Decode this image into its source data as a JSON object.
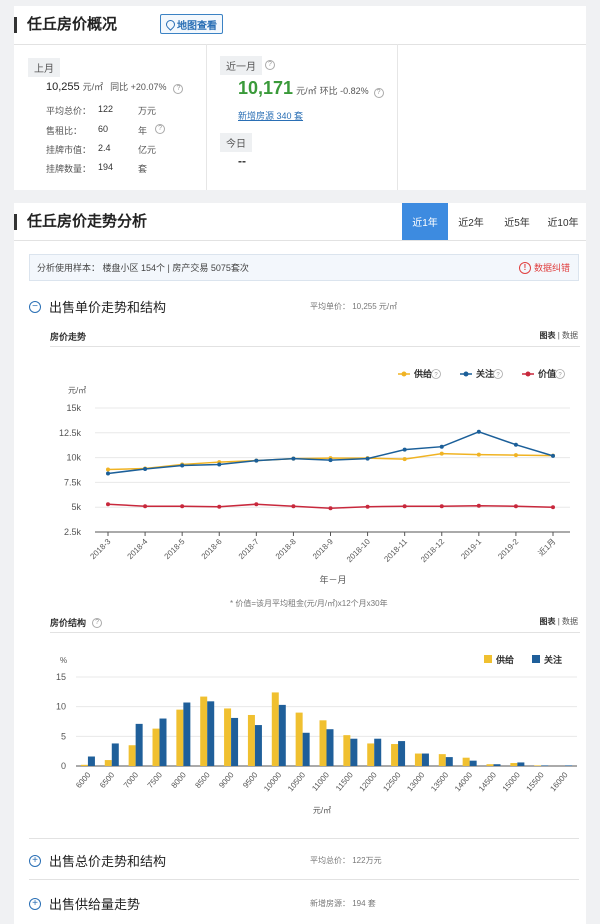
{
  "overview": {
    "title": "任丘房价概况",
    "map_button": "地图查看",
    "last_month": {
      "tag": "上月",
      "price": "10,255",
      "unit": "元/㎡",
      "yoy": "同比 +20.07%",
      "stats": [
        {
          "label": "平均总价：",
          "value": "122",
          "unit": "万元"
        },
        {
          "label": "售租比：",
          "value": "60",
          "unit": "年"
        },
        {
          "label": "挂牌市值：",
          "value": "2.4",
          "unit": "亿元"
        },
        {
          "label": "挂牌数量：",
          "value": "194",
          "unit": "套"
        }
      ]
    },
    "recent_month": {
      "tag": "近一月",
      "price": "10,171",
      "unit": "元/㎡",
      "mom": "环比 -0.82%",
      "new_listings": "新增房源 340 套"
    },
    "today": {
      "tag": "今日",
      "value": "--"
    }
  },
  "trend": {
    "title": "任丘房价走势分析",
    "tabs": [
      "近1年",
      "近2年",
      "近5年",
      "近10年"
    ],
    "active_tab": 0,
    "sample_text": "分析使用样本：  楼盘小区 154个   |   房产交易 5075套次",
    "error_label": "数据纠错",
    "unit_section": {
      "heading": "出售单价走势和结构",
      "avg": "平均单价：  10,255 元/㎡",
      "price_trend_label": "房价走势",
      "view_chart": "图表",
      "view_data": "数据",
      "footnote": "* 价值=该月平均租金(元/月/㎡)x12个月x30年",
      "structure_label": "房价结构"
    },
    "total_section": {
      "heading": "出售总价走势和结构",
      "avg": "平均总价：  122万元"
    },
    "supply_section": {
      "heading": "出售供给量走势",
      "avg": "新增房源：  194 套"
    }
  },
  "chart_data": [
    {
      "type": "line",
      "ylabel": "元/㎡",
      "xlabel": "年－月",
      "y_ticks": [
        "2.5k",
        "5k",
        "7.5k",
        "10k",
        "12.5k",
        "15k"
      ],
      "ylim": [
        2500,
        15000
      ],
      "categories": [
        "2018-3",
        "2018-4",
        "2018-5",
        "2018-6",
        "2018-7",
        "2018-8",
        "2018-9",
        "2018-10",
        "2018-11",
        "2018-12",
        "2019-1",
        "2019-2",
        "近1月"
      ],
      "series": [
        {
          "name": "供给",
          "color": "#f0b323",
          "values": [
            8800,
            8900,
            9300,
            9550,
            9700,
            9900,
            9950,
            9950,
            9850,
            10400,
            10300,
            10250,
            10200
          ]
        },
        {
          "name": "关注",
          "color": "#1b5f99",
          "values": [
            8400,
            8850,
            9200,
            9300,
            9700,
            9900,
            9750,
            9900,
            10800,
            11100,
            12600,
            11300,
            10171
          ]
        },
        {
          "name": "价值",
          "color": "#c8283c",
          "values": [
            5300,
            5100,
            5100,
            5050,
            5300,
            5100,
            4900,
            5050,
            5100,
            5100,
            5150,
            5100,
            5000
          ]
        }
      ],
      "legend": "top-right",
      "grid": true
    },
    {
      "type": "bar",
      "ylabel": "%",
      "xlabel": "元/㎡",
      "y_ticks": [
        "0",
        "5",
        "10",
        "15"
      ],
      "ylim": [
        0,
        15
      ],
      "categories": [
        "6000",
        "6500",
        "7000",
        "7500",
        "8000",
        "8500",
        "9000",
        "9500",
        "10000",
        "10500",
        "11000",
        "11500",
        "12000",
        "12500",
        "13000",
        "13500",
        "14000",
        "14500",
        "15000",
        "15500",
        "16000"
      ],
      "series": [
        {
          "name": "供给",
          "color": "#f0c030",
          "values": [
            0.2,
            1.0,
            3.5,
            6.3,
            9.5,
            11.7,
            9.7,
            8.6,
            12.4,
            9.0,
            7.7,
            5.2,
            3.8,
            3.7,
            2.1,
            2.0,
            1.4,
            0.3,
            0.5,
            0.1,
            0.0
          ]
        },
        {
          "name": "关注",
          "color": "#1f5f9a",
          "values": [
            1.6,
            3.8,
            7.1,
            8.0,
            10.7,
            10.9,
            8.1,
            6.9,
            10.3,
            5.6,
            6.2,
            4.6,
            4.6,
            4.2,
            2.1,
            1.5,
            0.9,
            0.3,
            0.6,
            0.1,
            0.1
          ]
        }
      ],
      "legend": "top-right",
      "grid": true
    }
  ]
}
